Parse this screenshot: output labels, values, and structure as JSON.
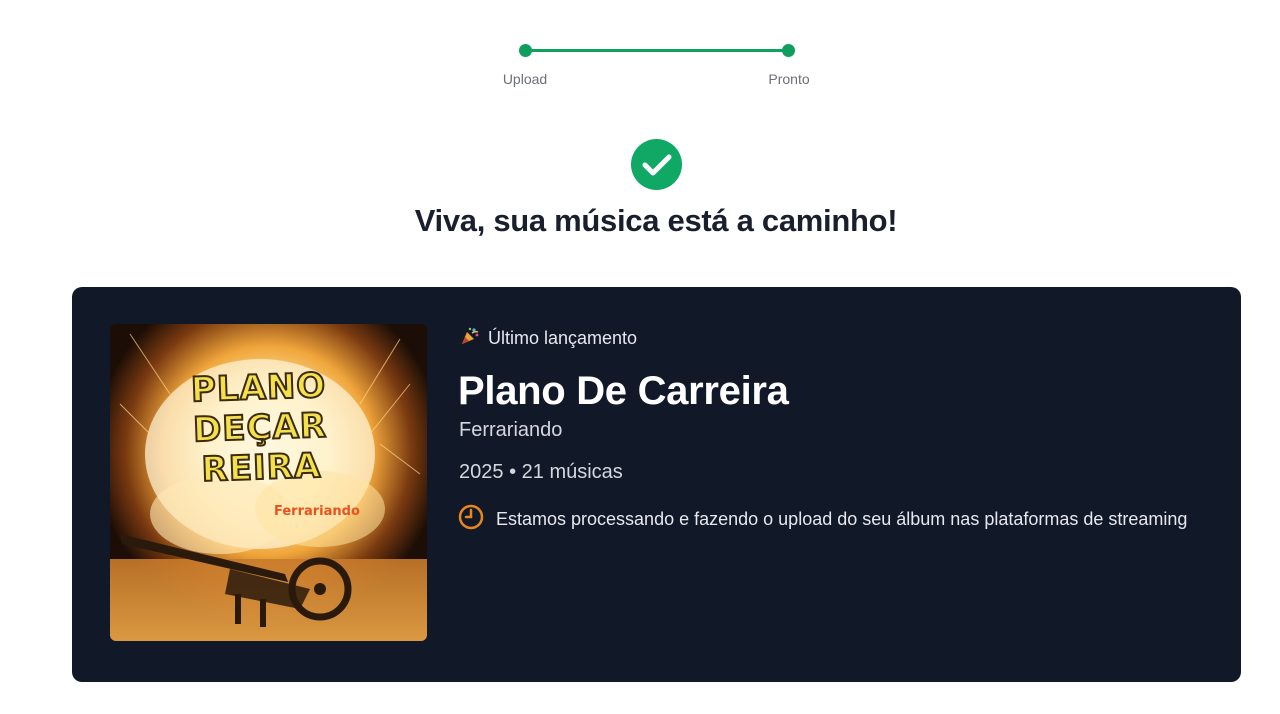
{
  "stepper": {
    "steps": [
      {
        "label": "Upload"
      },
      {
        "label": "Pronto"
      }
    ]
  },
  "headline": "Viva, sua música está a caminho!",
  "release": {
    "badge_icon": "party-popper-icon",
    "badge_label": "Último lançamento",
    "title": "Plano De Carreira",
    "artist": "Ferrariando",
    "year": "2025",
    "separator": "•",
    "track_count": "21 músicas",
    "status_icon": "clock-icon",
    "status_text": "Estamos processando e fazendo o upload do seu álbum nas plataformas de streaming",
    "cover_art": {
      "title_lines": [
        "PLANO",
        "DEÇAR",
        "REIRA"
      ],
      "artist": "Ferrariando"
    }
  },
  "colors": {
    "accent_green": "#0f9e5e",
    "card_bg": "#111828",
    "status_orange": "#e8871e"
  }
}
